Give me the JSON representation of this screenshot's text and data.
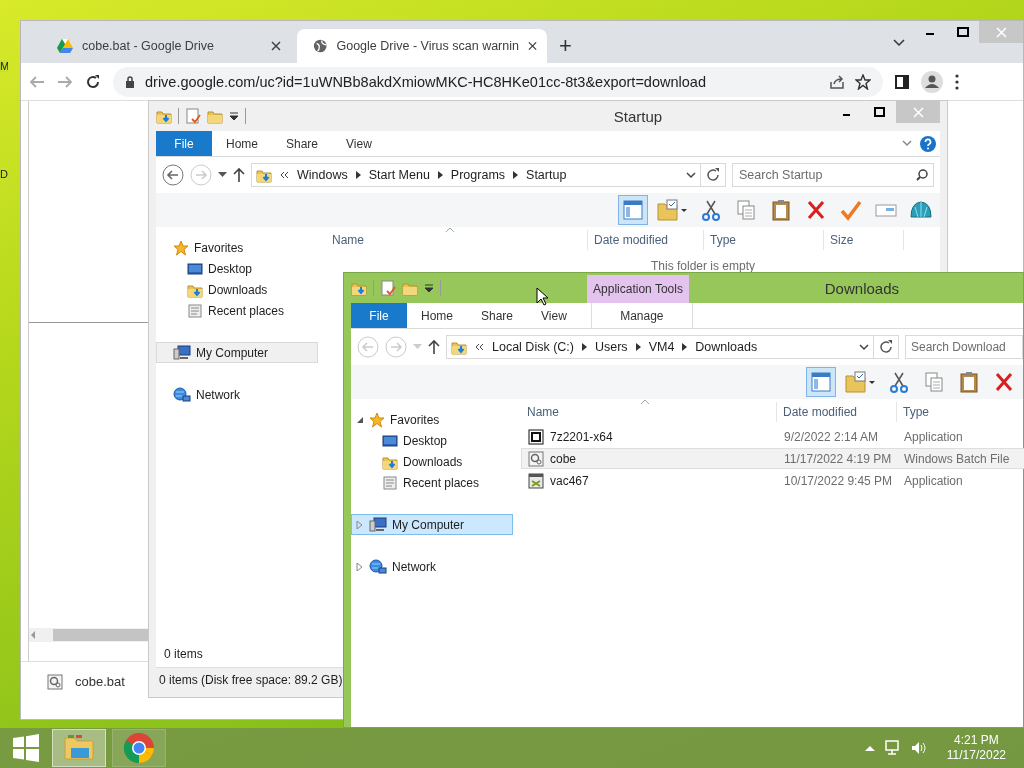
{
  "desktop": {
    "edge_labels": [
      "M",
      "D"
    ]
  },
  "browser": {
    "tabs": [
      {
        "title": "cobe.bat - Google Drive",
        "selected": false,
        "kind": "drive"
      },
      {
        "title": "Google Drive - Virus scan warnin",
        "selected": true,
        "kind": "globe"
      }
    ],
    "new_tab": "+",
    "url": "drive.google.com/uc?id=1uWNBb8akdXmiowMKC-HC8HKe01cc-8t3&export=download",
    "download": {
      "file": "cobe.bat"
    }
  },
  "explorers": [
    {
      "title": "Startup",
      "active": false,
      "ribbon_tabs": [
        {
          "label": "File",
          "kind": "file"
        },
        {
          "label": "Home",
          "kind": "plain"
        },
        {
          "label": "Share",
          "kind": "plain"
        },
        {
          "label": "View",
          "kind": "plain"
        }
      ],
      "breadcrumb": [
        "Windows",
        "Start Menu",
        "Programs",
        "Startup"
      ],
      "search": {
        "placeholder": "Search Startup"
      },
      "toolbar": [
        {
          "kind": "preview-pane",
          "selected": true
        },
        {
          "kind": "folder-check",
          "selected": false
        },
        {
          "kind": "cut",
          "selected": false
        },
        {
          "kind": "copy",
          "selected": false
        },
        {
          "kind": "paste",
          "selected": false
        },
        {
          "kind": "delete",
          "selected": false
        },
        {
          "kind": "check",
          "selected": false
        },
        {
          "kind": "rename",
          "selected": false
        },
        {
          "kind": "shell",
          "selected": false
        }
      ],
      "nav": [
        {
          "label": "Favorites",
          "kind": "favorites",
          "selected": false,
          "children": [
            {
              "label": "Desktop",
              "kind": "desktop",
              "selected": false
            },
            {
              "label": "Downloads",
              "kind": "downloads",
              "selected": false
            },
            {
              "label": "Recent places",
              "kind": "recent",
              "selected": false
            }
          ]
        },
        {
          "label": "My Computer",
          "kind": "computer",
          "selected": true
        },
        {
          "label": "Network",
          "kind": "network",
          "selected": false
        }
      ],
      "columns": [
        "Name",
        "Date modified",
        "Type",
        "Size"
      ],
      "empty_message": "This folder is empty",
      "status": "0 items",
      "details": "0 items (Disk free space: 89.2 GB)"
    },
    {
      "title": "Downloads",
      "active": true,
      "context_group": {
        "label": "Application Tools"
      },
      "ribbon_tabs": [
        {
          "label": "File",
          "kind": "file"
        },
        {
          "label": "Home",
          "kind": "plain"
        },
        {
          "label": "Share",
          "kind": "plain"
        },
        {
          "label": "View",
          "kind": "plain"
        },
        {
          "label": "Manage",
          "kind": "context"
        }
      ],
      "breadcrumb": [
        "Local Disk (C:)",
        "Users",
        "VM4",
        "Downloads"
      ],
      "search": {
        "placeholder": "Search Download"
      },
      "toolbar": [
        {
          "kind": "preview-pane",
          "selected": true
        },
        {
          "kind": "folder-check",
          "selected": false
        },
        {
          "kind": "cut",
          "selected": false
        },
        {
          "kind": "copy",
          "selected": false
        },
        {
          "kind": "paste",
          "selected": false
        },
        {
          "kind": "delete",
          "selected": false
        }
      ],
      "nav": [
        {
          "label": "Favorites",
          "kind": "favorites",
          "selected": false,
          "expanded": true,
          "children": [
            {
              "label": "Desktop",
              "kind": "desktop",
              "selected": false
            },
            {
              "label": "Downloads",
              "kind": "downloads",
              "selected": false
            },
            {
              "label": "Recent places",
              "kind": "recent",
              "selected": false
            }
          ]
        },
        {
          "label": "My Computer",
          "kind": "computer",
          "selected": true,
          "expanded": false
        },
        {
          "label": "Network",
          "kind": "network",
          "selected": false,
          "expanded": false
        }
      ],
      "columns": [
        "Name",
        "Date modified",
        "Type"
      ],
      "files": [
        {
          "name": "7z2201-x64",
          "date": "9/2/2022 2:14 AM",
          "type": "Application",
          "kind": "archive-app",
          "selected": false
        },
        {
          "name": "cobe",
          "date": "11/17/2022 4:19 PM",
          "type": "Windows Batch File",
          "kind": "batch",
          "selected": true
        },
        {
          "name": "vac467",
          "date": "10/17/2022 9:45 PM",
          "type": "Application",
          "kind": "app",
          "selected": false
        }
      ]
    }
  ],
  "taskbar": {
    "apps": [
      {
        "kind": "explorer",
        "selected": true
      },
      {
        "kind": "chrome",
        "selected": false
      }
    ],
    "time": "4:21 PM",
    "date": "11/17/2022"
  }
}
